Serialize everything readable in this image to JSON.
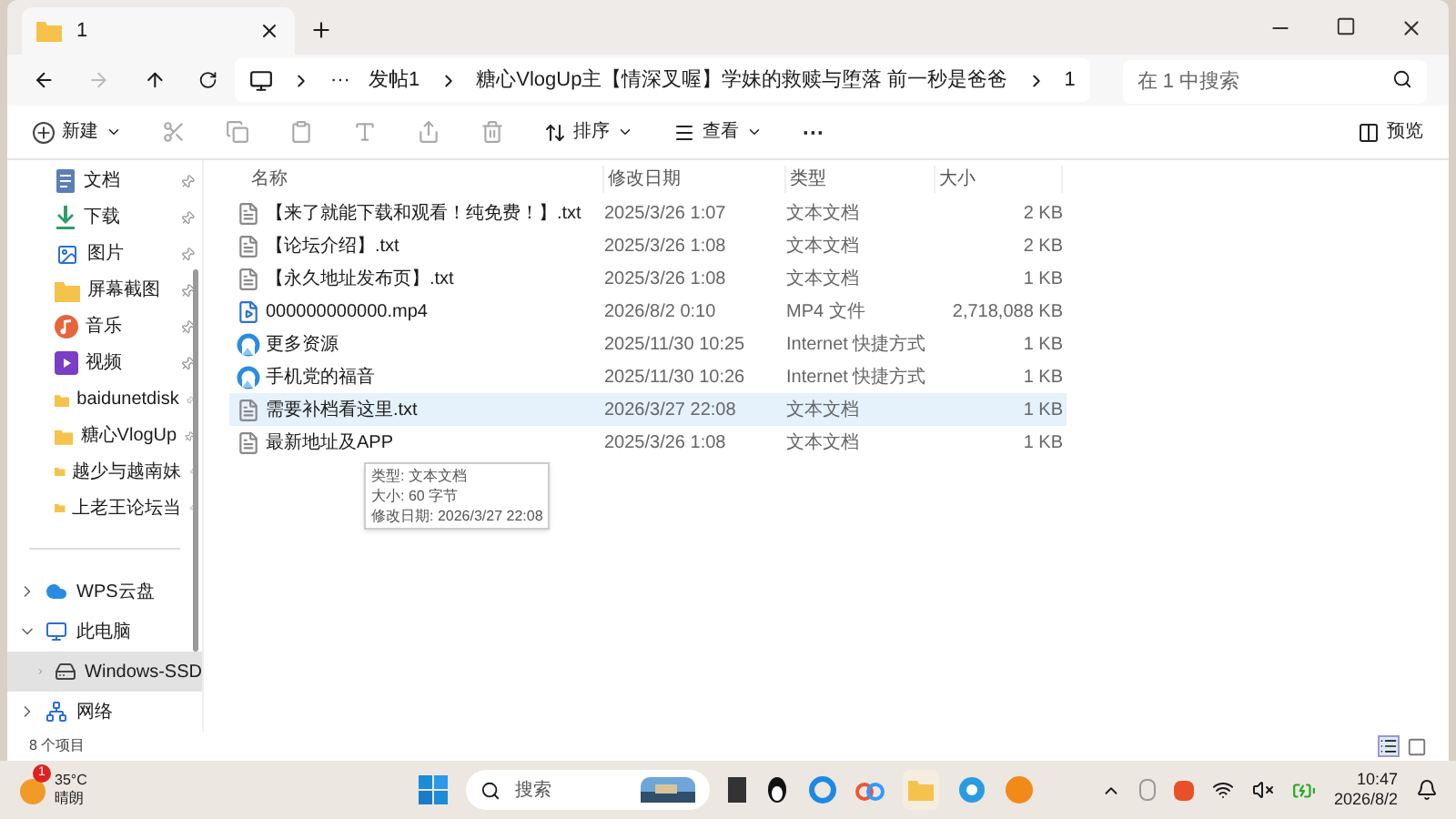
{
  "window": {
    "tab_title": "1",
    "overflow": "···",
    "breadcrumbs": [
      "发帖1",
      "糖心VlogUp主【情深叉喔】学妹的救赎与堕落 前一秒是爸爸",
      "1"
    ],
    "search": {
      "placeholder": "在 1 中搜索"
    }
  },
  "toolbar": {
    "new": "新建",
    "sort": "排序",
    "view": "查看",
    "more": "···",
    "preview": "预览"
  },
  "quick_access": [
    {
      "label": "文档",
      "kind": "docs",
      "pinned": true
    },
    {
      "label": "下载",
      "kind": "download",
      "pinned": true
    },
    {
      "label": "图片",
      "kind": "pictures",
      "pinned": true
    },
    {
      "label": "屏幕截图",
      "kind": "folder",
      "pinned": true
    },
    {
      "label": "音乐",
      "kind": "music",
      "pinned": true
    },
    {
      "label": "视频",
      "kind": "video",
      "pinned": true
    },
    {
      "label": "baidunetdisk",
      "kind": "folder",
      "pinned": true
    },
    {
      "label": "糖心VlogUp",
      "kind": "folder",
      "pinned": true
    },
    {
      "label": "越少与越南妹",
      "kind": "folder",
      "pinned": true
    },
    {
      "label": "上老王论坛当",
      "kind": "folder",
      "pinned": true
    }
  ],
  "nav_tree": [
    {
      "label": "WPS云盘",
      "kind": "cloud",
      "expanded": false,
      "selected": false
    },
    {
      "label": "此电脑",
      "kind": "pc",
      "expanded": true,
      "selected": false,
      "children": [
        {
          "label": "Windows-SSD",
          "kind": "drive",
          "expanded": false,
          "selected": true
        }
      ]
    },
    {
      "label": "网络",
      "kind": "network",
      "expanded": false,
      "selected": false
    }
  ],
  "table": {
    "columns": [
      "名称",
      "修改日期",
      "类型",
      "大小"
    ],
    "rows": [
      {
        "name": "【来了就能下载和观看！纯免费！】.txt",
        "date": "2025/3/26 1:07",
        "type": "文本文档",
        "size": "2 KB",
        "kind": "txt",
        "selected": false
      },
      {
        "name": "【论坛介绍】.txt",
        "date": "2025/3/26 1:08",
        "type": "文本文档",
        "size": "2 KB",
        "kind": "txt",
        "selected": false
      },
      {
        "name": "【永久地址发布页】.txt",
        "date": "2025/3/26 1:08",
        "type": "文本文档",
        "size": "1 KB",
        "kind": "txt",
        "selected": false
      },
      {
        "name": "000000000000.mp4",
        "date": "2026/8/2 0:10",
        "type": "MP4 文件",
        "size": "2,718,088 KB",
        "kind": "mp4",
        "selected": false
      },
      {
        "name": "更多资源",
        "date": "2025/11/30 10:25",
        "type": "Internet 快捷方式",
        "size": "1 KB",
        "kind": "link",
        "selected": false
      },
      {
        "name": "手机党的福音",
        "date": "2025/11/30 10:26",
        "type": "Internet 快捷方式",
        "size": "1 KB",
        "kind": "link",
        "selected": false
      },
      {
        "name": "需要补档看这里.txt",
        "date": "2026/3/27 22:08",
        "type": "文本文档",
        "size": "1 KB",
        "kind": "txt",
        "selected": true
      },
      {
        "name": "最新地址及APP",
        "date": "2025/3/26 1:08",
        "type": "文本文档",
        "size": "1 KB",
        "kind": "txt",
        "selected": false
      }
    ]
  },
  "tooltip": [
    "类型: 文本文档",
    "大小: 60 字节",
    "修改日期: 2026/3/27 22:08"
  ],
  "status_bar": {
    "count": "8 个项目"
  },
  "taskbar": {
    "weather": {
      "temperature": "35°C",
      "condition": "晴朗",
      "badge": "1"
    },
    "search": "搜索",
    "time": "10:47",
    "date": "2026/8/2"
  }
}
